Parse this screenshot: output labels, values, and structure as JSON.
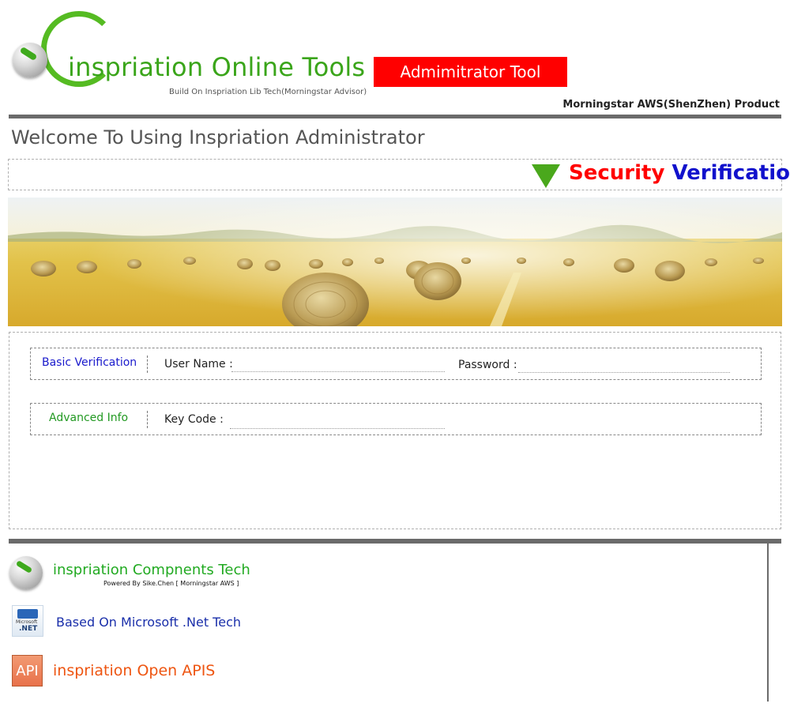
{
  "header": {
    "logo_title": "inspriation Online Tools",
    "logo_subtitle": "Build On Inspriation Lib Tech(Morningstar Advisor)",
    "admin_badge": "Admimitrator Tool",
    "product_line": "Morningstar AWS(ShenZhen) Product"
  },
  "main": {
    "welcome": "Welcome To Using Inspriation Administrator",
    "security": {
      "word1": "Security",
      "word2": "Verification"
    }
  },
  "form": {
    "basic_legend": "Basic Verification",
    "username_label": "User Name :",
    "username_value": "",
    "password_label": "Password :",
    "password_value": "",
    "advanced_legend": "Advanced Info",
    "keycode_label": "Key Code :",
    "keycode_value": ""
  },
  "footer": {
    "components_title": "inspriation Compnents Tech",
    "components_sub": "Powered By Sike.Chen [ Morningstar AWS ]",
    "net_icon_small": "Microsoft",
    "net_icon_text": ".NET",
    "net_title": "Based On Microsoft .Net Tech",
    "api_icon": "API",
    "api_title": "inspriation Open APIS"
  },
  "colors": {
    "brand_green": "#3aa51a",
    "admin_red": "#ff0000",
    "security_red": "#ff0000",
    "security_blue": "#1111cc",
    "rule_gray": "#6b6b6b",
    "api_orange": "#ee5511"
  },
  "icons": [
    "logo-ball-icon",
    "down-arrow-icon",
    "dotnet-icon",
    "api-icon"
  ]
}
